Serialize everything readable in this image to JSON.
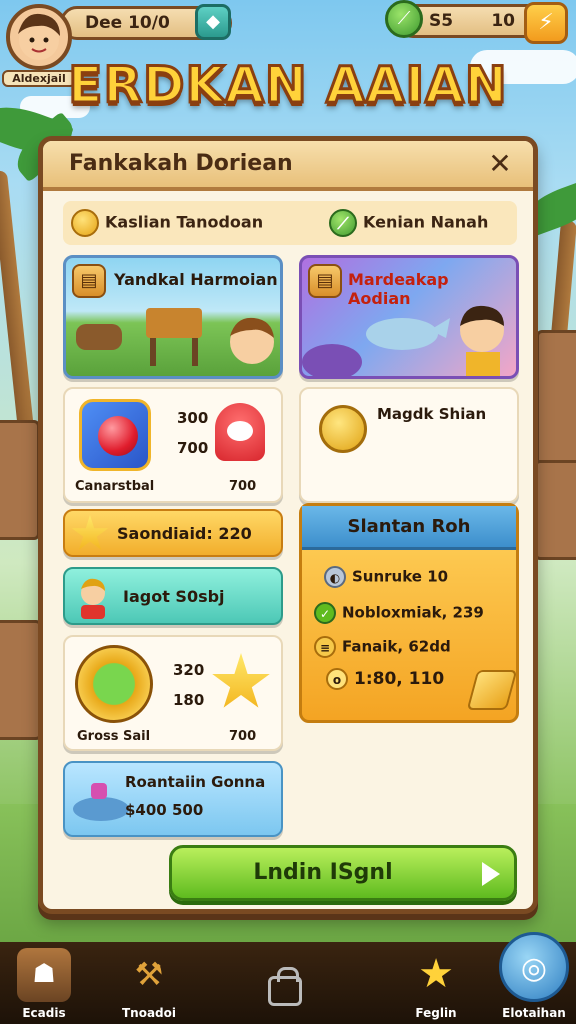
{
  "hud": {
    "player_name": "Aldexjail",
    "left_pill_text": "Dee 10/0",
    "right_pill_text": "S5",
    "right_pill_value": "10"
  },
  "title": "ERDKAN AAIAN",
  "panel": {
    "title": "Fankakah Doriean",
    "close_label": "✕",
    "resources": [
      {
        "label": "Kaslian Tanodoan",
        "icon": "gold-coin-icon"
      },
      {
        "label": "Kenian Nanah",
        "icon": "leaf-coin-icon"
      }
    ],
    "scene_left": {
      "title": "Yandkal Harmoian"
    },
    "scene_right": {
      "title": "Mardeakap Aodian"
    },
    "gem_card": {
      "num1": "300",
      "num2": "700",
      "caption_left": "Canarstbal",
      "caption_right": "700"
    },
    "gold_card": {
      "title": "Magdk Shian"
    },
    "orange_bar": {
      "label": "Saondiaid: 220"
    },
    "teal_bar": {
      "label": "Iagot S0sbj"
    },
    "frog_card": {
      "num1": "320",
      "num2": "180",
      "caption_left": "Gross Sail",
      "caption_right": "700"
    },
    "blue_bar": {
      "line1": "Roantaiin Gonna",
      "line2": "$400 500"
    },
    "summary": {
      "header": "Slantan Roh",
      "rows": [
        {
          "text": "Sunruke 10",
          "icon": "compass-icon"
        },
        {
          "text": "Nobloxmiak, 239",
          "icon": "leaf-icon"
        },
        {
          "text": "Fanaik, 62dd",
          "icon": "coin-stack-icon"
        },
        {
          "text": "1:80, 110",
          "icon": "coin-icon"
        }
      ]
    },
    "cta_label": "Lndin ISgnl"
  },
  "nav": {
    "items": [
      {
        "label": "Ecadis",
        "icon": "helmet-icon"
      },
      {
        "label": "Tnoadoi",
        "icon": "hammer-icon"
      },
      {
        "label": "Feglin",
        "icon": "star-icon"
      },
      {
        "label": "Elotaihan",
        "icon": "globe-icon"
      }
    ]
  },
  "colors": {
    "frame": "#7a4a22",
    "title_fill": "#ffd23a",
    "cta": "#5fbb1f",
    "panel_bg": "#fbf4e3"
  }
}
